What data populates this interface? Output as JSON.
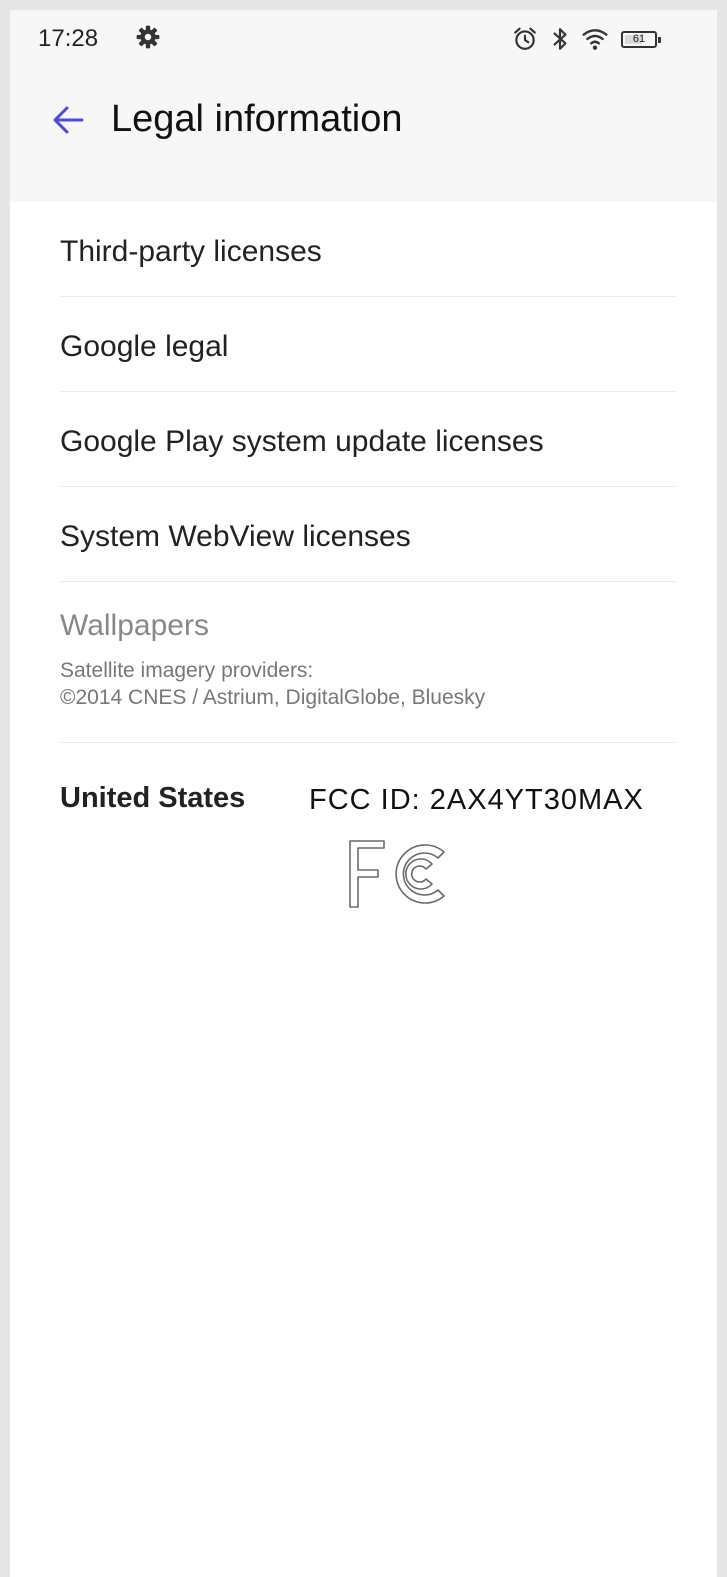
{
  "status_bar": {
    "time": "17:28",
    "battery_level": "61",
    "battery_fraction": 0.61,
    "icons": [
      "gear-icon",
      "alarm-icon",
      "bluetooth-icon",
      "wifi-icon",
      "battery-icon"
    ]
  },
  "header": {
    "title": "Legal information",
    "back_icon": "arrow-left-icon",
    "accent_color": "#4a4ae0"
  },
  "menu": {
    "items": [
      {
        "label": "Third-party licenses"
      },
      {
        "label": "Google legal"
      },
      {
        "label": "Google Play system update licenses"
      },
      {
        "label": "System WebView licenses"
      }
    ]
  },
  "wallpapers": {
    "title": "Wallpapers",
    "line1": "Satellite imagery providers:",
    "line2": "©2014 CNES / Astrium, DigitalGlobe, Bluesky"
  },
  "regulatory": {
    "region": "United States",
    "fcc_id": "FCC ID: 2AX4YT30MAX",
    "logo_icon": "fcc-logo"
  }
}
